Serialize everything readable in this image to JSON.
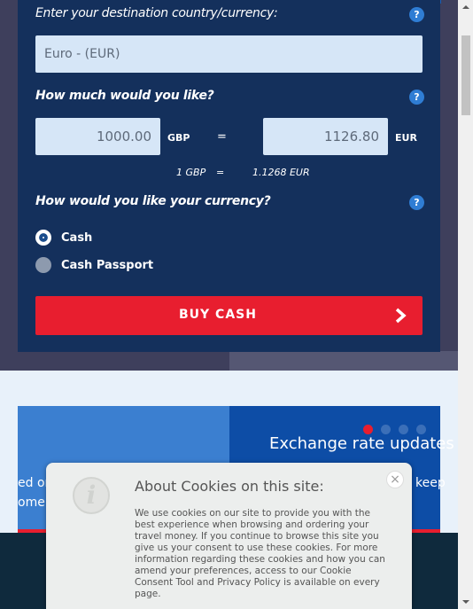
{
  "form": {
    "destination_label": "Enter your destination country/currency:",
    "destination_value": "Euro - (EUR)",
    "amount_label": "How much would you like?",
    "from_amount": "1000.00",
    "from_currency": "GBP",
    "equals": "=",
    "to_amount": "1126.80",
    "to_currency": "EUR",
    "rate": {
      "left": "1 GBP",
      "equals": "=",
      "right": "1.1268 EUR"
    },
    "type_label": "How would you like your currency?",
    "options": [
      {
        "label": "Cash",
        "selected": true
      },
      {
        "label": "Cash Passport",
        "selected": false
      }
    ],
    "buy_label": "BUY CASH",
    "help_glyph": "?"
  },
  "banner": {
    "title": "Exchange rate updates",
    "left_fragment_1": "ed on",
    "left_fragment_2": "ome",
    "right_fragment": "keep",
    "slides": 4,
    "active_slide": 1
  },
  "cookie": {
    "title": "About Cookies on this site:",
    "body": "We use cookies on our site to provide you with the best experience when browsing and ordering your travel money. If you continue to browse this site you give us your consent to use these cookies. For more information regarding these cookies and how you can amend your preferences, access to our Cookie Consent Tool and Privacy Policy is available on every page.",
    "icon_glyph": "i",
    "close_glyph": "×"
  },
  "colors": {
    "card": "#14305c",
    "accent_red": "#e81e2f",
    "input_bg": "#d6e6f7",
    "help_blue": "#2f7dd4"
  }
}
